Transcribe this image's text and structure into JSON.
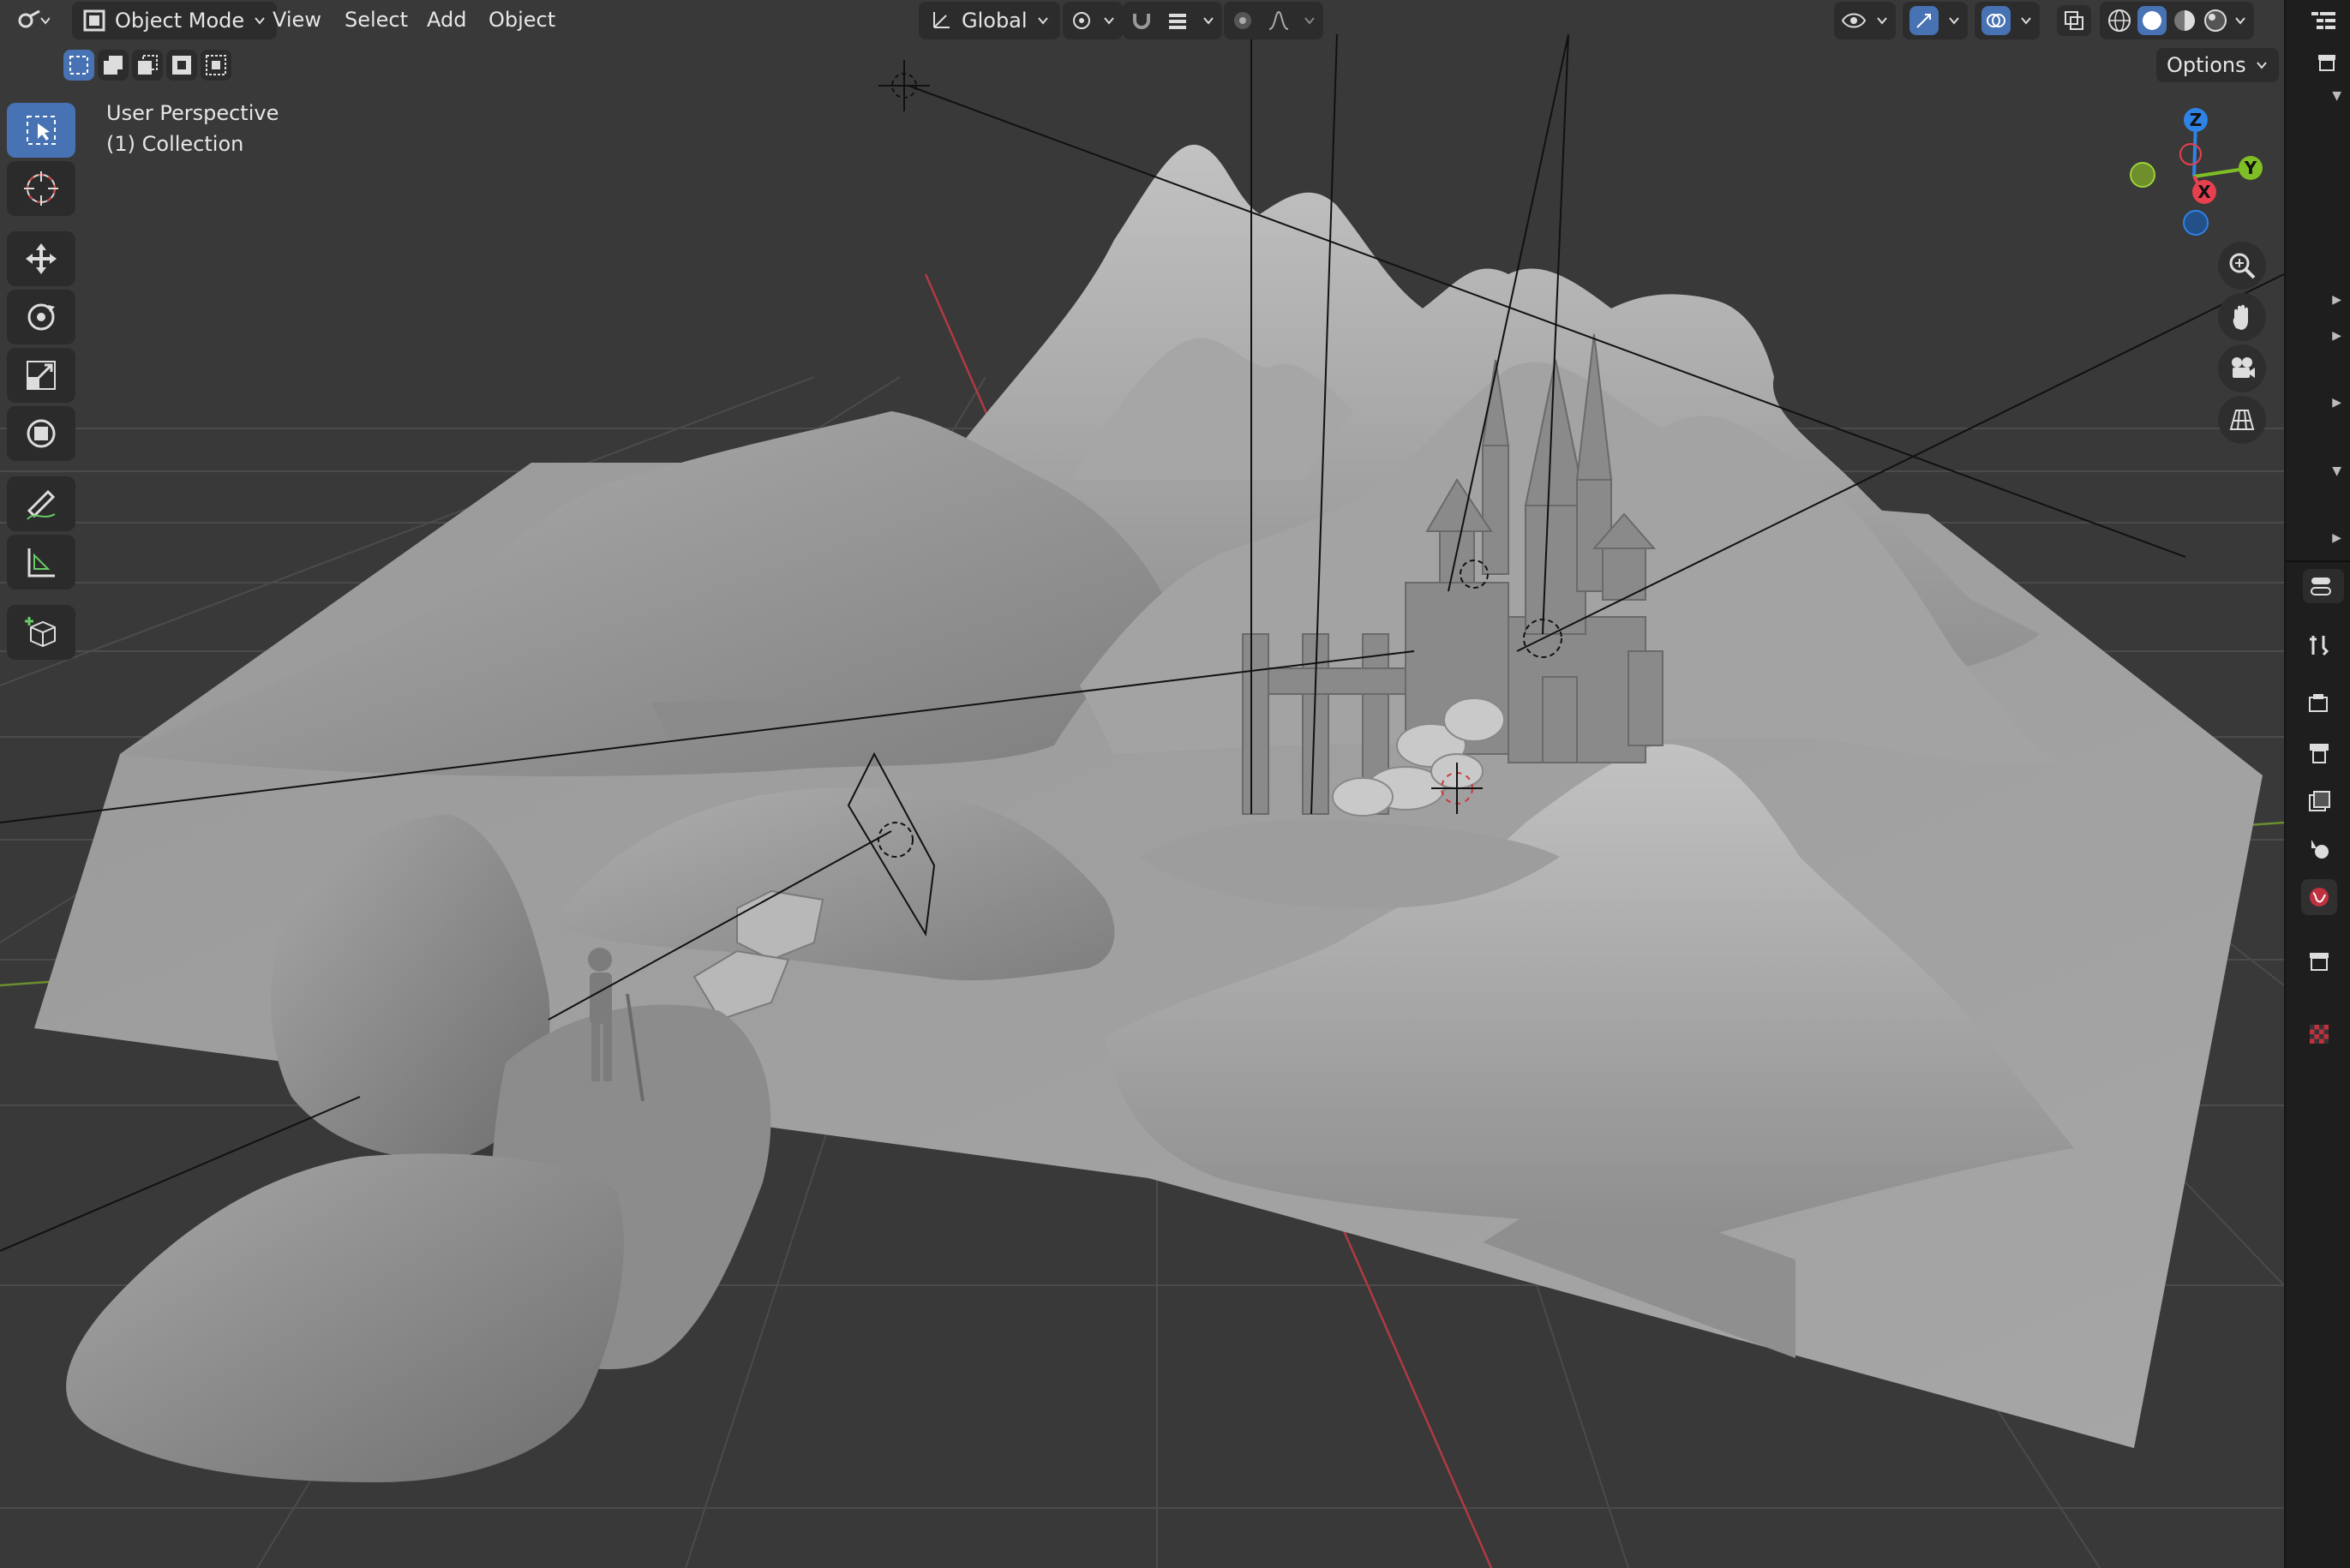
{
  "header": {
    "editor_type_icon": "editor-type-icon",
    "mode": {
      "label": "Object Mode",
      "icon": "object-mode-icon"
    },
    "menus": [
      "View",
      "Select",
      "Add",
      "Object"
    ],
    "transform_orientation": "Global",
    "options_label": "Options"
  },
  "overlay_text": {
    "view_name": "User Perspective",
    "collection": "(1) Collection"
  },
  "toolbar": {
    "tools": [
      "select-box-icon",
      "cursor-icon",
      "move-icon",
      "rotate-icon",
      "scale-icon",
      "transform-icon",
      "annotate-icon",
      "measure-icon",
      "add-cube-icon"
    ],
    "active_tool": "select-box-icon"
  },
  "gizmo": {
    "axes": {
      "x": "X",
      "y": "Y",
      "z": "Z"
    },
    "colors": {
      "x": "#e8404f",
      "y": "#7fbf25",
      "z": "#2f82e6"
    }
  },
  "navigation": [
    "zoom-icon",
    "pan-hand-icon",
    "camera-view-icon",
    "ortho-grid-icon"
  ],
  "properties_tabs": [
    "tool-icon",
    "render-icon",
    "output-icon",
    "view-layer-icon",
    "scene-icon",
    "world-icon",
    "collection-icon",
    "texture-icon"
  ],
  "colors": {
    "viewport_bg": "#393939",
    "grid": "#4a4a4a",
    "x_axis": "#b03a44",
    "y_axis": "#6a8f2e",
    "accent": "#4772b3",
    "terrain": "#9a9a9a"
  }
}
